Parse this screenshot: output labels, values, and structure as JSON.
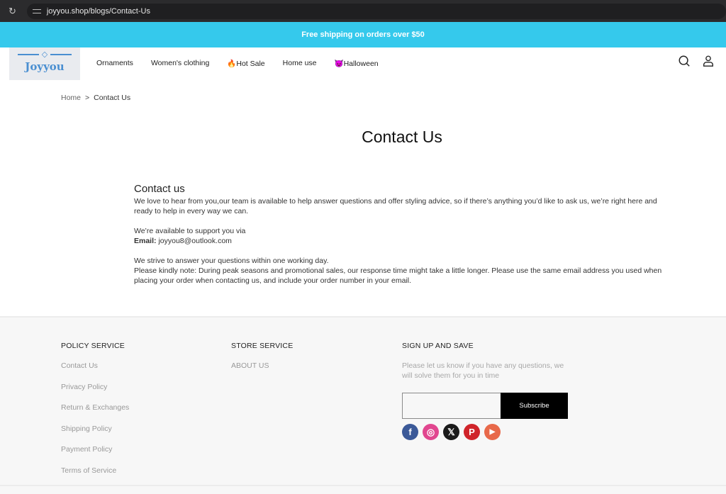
{
  "browser": {
    "url": "joyyou.shop/blogs/Contact-Us"
  },
  "announcement": "Free shipping on orders over $50",
  "logo": {
    "text": "Joyyou",
    "color": "#4a8fd1"
  },
  "nav": [
    {
      "label": "Ornaments"
    },
    {
      "label": "Women's clothing"
    },
    {
      "label": "🔥Hot Sale"
    },
    {
      "label": "Home use"
    },
    {
      "label": "😈Halloween"
    }
  ],
  "header_icons": [
    "search-icon",
    "user-icon"
  ],
  "breadcrumb": {
    "home": "Home",
    "sep": ">",
    "current": "Contact Us"
  },
  "page_title": "Contact Us",
  "content": {
    "heading": "Contact us",
    "intro": "We love to hear from you,our team is available to help answer questions and offer styling advice, so if there’s anything you’d like to ask us, we’re right here and ready to help in every way we can.",
    "support_via": "We’re available to support you via",
    "email_label": "Email:",
    "email_value": "joyyou8@outlook.com",
    "response": "We strive to answer your questions within one working day.",
    "note": "Please kindly note: During peak seasons and promotional sales, our response time might take a little longer. Please use the same email address you used when placing your order when contacting us, and include your order number in your email."
  },
  "footer": {
    "policy": {
      "title": "POLICY SERVICE",
      "links": [
        "Contact Us",
        "Privacy Policy",
        "Return & Exchanges",
        "Shipping Policy",
        "Payment Policy",
        "Terms of Service"
      ]
    },
    "store": {
      "title": "STORE SERVICE",
      "links": [
        "ABOUT US"
      ]
    },
    "signup": {
      "title": "SIGN UP AND SAVE",
      "description": "Please let us know if you have any questions, we will solve them for you in time",
      "email_value": "",
      "button": "Subscribe"
    },
    "social": [
      {
        "name": "facebook",
        "glyph": "f",
        "color": "#3b5998"
      },
      {
        "name": "instagram",
        "glyph": "◎",
        "color": "#e1468f"
      },
      {
        "name": "x",
        "glyph": "𝕏",
        "color": "#1a1a1a"
      },
      {
        "name": "pinterest",
        "glyph": "P",
        "color": "#d0242a"
      },
      {
        "name": "youtube",
        "glyph": "▶",
        "color": "#e8694a"
      }
    ]
  },
  "colors": {
    "announcement_bg": "#35c9ec",
    "footer_bg": "#f7f7f7"
  }
}
